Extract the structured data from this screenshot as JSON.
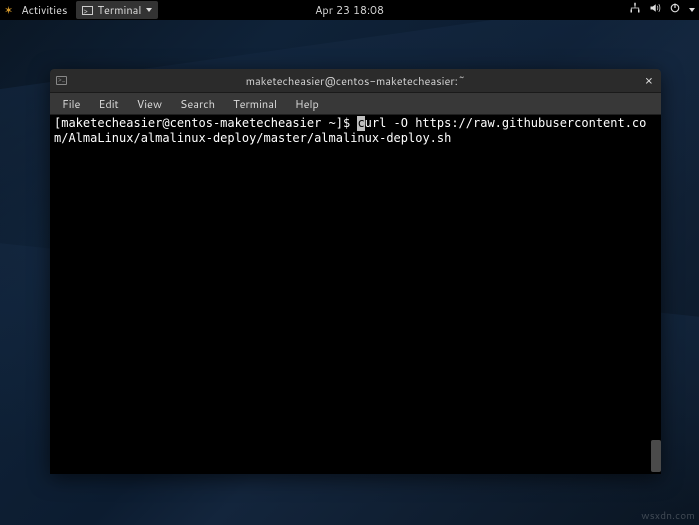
{
  "topbar": {
    "activities_label": "Activities",
    "app_menu_label": "Terminal",
    "clock": "Apr 23  18:08"
  },
  "window": {
    "title": "maketecheasier@centos-maketecheasier:~",
    "menubar": [
      "File",
      "Edit",
      "View",
      "Search",
      "Terminal",
      "Help"
    ],
    "prompt": "[maketecheasier@centos-maketecheasier ~]$ ",
    "command_first_char": "c",
    "command_rest": "url -O https://raw.githubusercontent.com/AlmaLinux/almalinux-deploy/master/almalinux-deploy.sh"
  },
  "watermark": "wsxdn.com"
}
